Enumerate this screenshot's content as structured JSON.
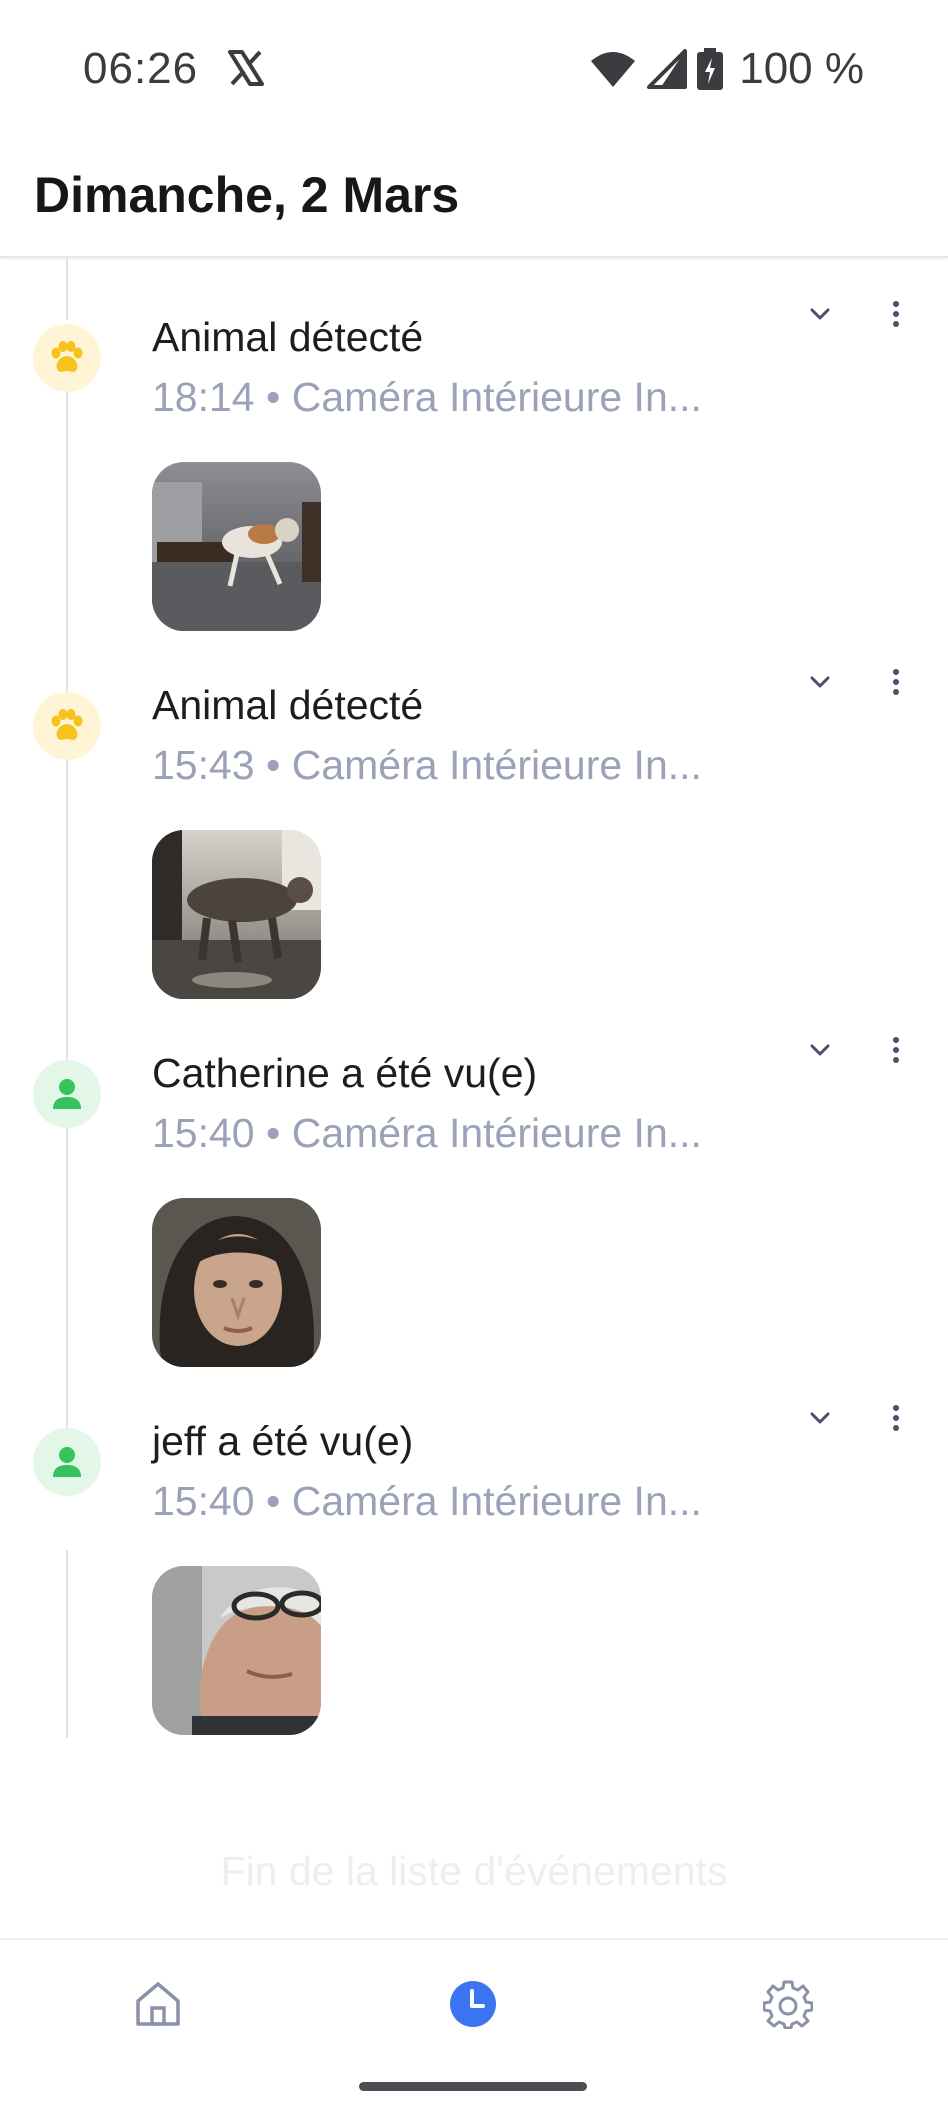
{
  "status_bar": {
    "time": "06:26",
    "app_icon": "x-icon",
    "battery": "100 %"
  },
  "header": {
    "title": "Dimanche, 2 Mars"
  },
  "events": [
    {
      "type": "animal",
      "icon": "paw-icon",
      "title": "Animal détecté",
      "meta": "18:14 • Caméra Intérieure In..."
    },
    {
      "type": "animal",
      "icon": "paw-icon",
      "title": "Animal détecté",
      "meta": "15:43 • Caméra Intérieure In..."
    },
    {
      "type": "person",
      "icon": "person-icon",
      "title": "Catherine a été vu(e)",
      "meta": "15:40 • Caméra Intérieure In..."
    },
    {
      "type": "person",
      "icon": "person-icon",
      "title": "jeff a été vu(e)",
      "meta": "15:40 • Caméra Intérieure In..."
    }
  ],
  "end_of_list": "Fin de la liste d'événements",
  "nav": {
    "items": [
      "home-icon",
      "history-icon",
      "settings-icon"
    ],
    "active": "history-icon"
  },
  "colors": {
    "accent": "#3b74f0",
    "animal": "#f7c21b",
    "person": "#34c45c",
    "meta_text": "#9aa1b9"
  }
}
